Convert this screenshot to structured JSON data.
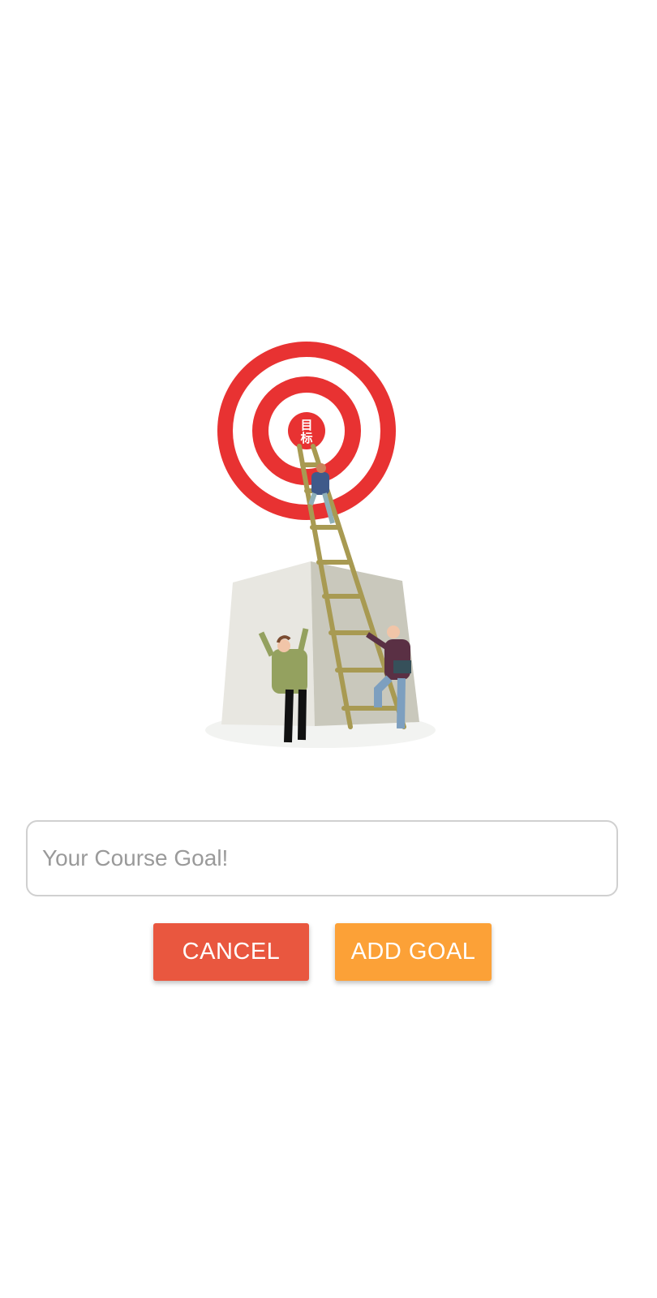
{
  "illustration": {
    "target_label": "目标"
  },
  "goal_input": {
    "placeholder": "Your Course Goal!",
    "value": ""
  },
  "buttons": {
    "cancel_label": "CANCEL",
    "add_label": "ADD GOAL"
  },
  "colors": {
    "cancel": "#e9573f",
    "add": "#fca137",
    "target_red": "#e83232"
  }
}
